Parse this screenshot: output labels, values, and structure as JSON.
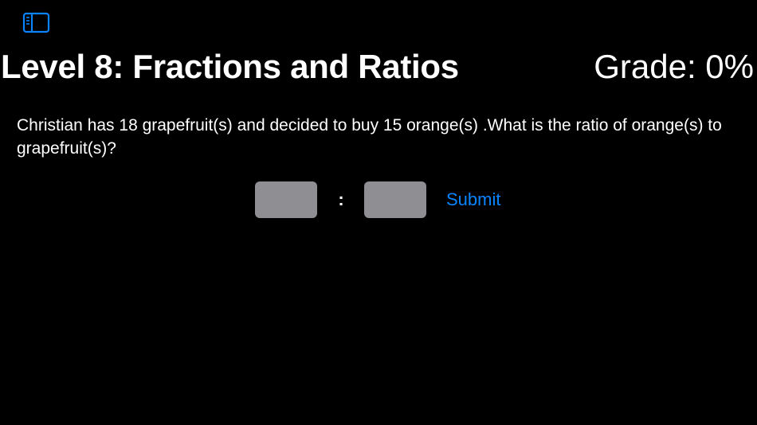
{
  "header": {
    "sidebar_icon": "sidebar-toggle-icon",
    "title": "Level 8: Fractions and Ratios",
    "grade": "Grade: 0%"
  },
  "question": {
    "text": "Christian has 18 grapefruit(s) and decided to buy 15 orange(s) .What is the ratio of orange(s) to grapefruit(s)?"
  },
  "answer": {
    "first_value": "",
    "separator": ":",
    "second_value": "",
    "submit_label": "Submit"
  },
  "colors": {
    "background": "#000000",
    "text": "#ffffff",
    "accent": "#0a84ff",
    "input_fill": "#8e8e93"
  }
}
